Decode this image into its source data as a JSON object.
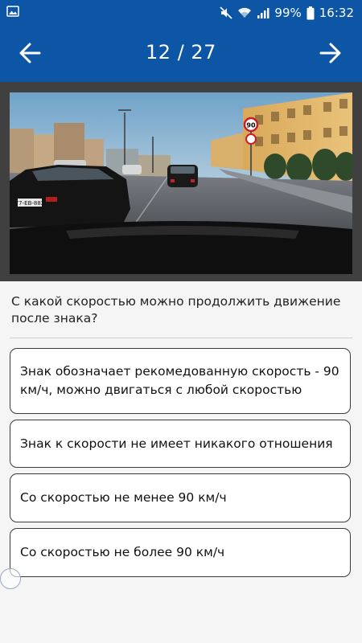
{
  "status_bar": {
    "battery": "99%",
    "time": "16:32",
    "icons": [
      "image-icon",
      "mute-icon",
      "wifi-icon",
      "signal-icon",
      "battery-icon"
    ]
  },
  "header": {
    "counter": "12 / 27",
    "back_icon": "arrow-left-icon",
    "next_icon": "arrow-right-icon",
    "background": "#0c56a5"
  },
  "photo": {
    "sign_value": "90",
    "plate_text": "77-ЕВ-882"
  },
  "question": {
    "text": "С какой скоростью можно продолжить движение после знака?"
  },
  "answers": [
    {
      "label": "Знак обозначает рекомедованную скорость - 90 км/ч, можно двигаться с любой скоростью"
    },
    {
      "label": "Знак к скорости не имеет никакого отношения"
    },
    {
      "label": "Со скоростью не менее 90 км/ч"
    },
    {
      "label": "Со скоростью не более 90 км/ч"
    }
  ]
}
